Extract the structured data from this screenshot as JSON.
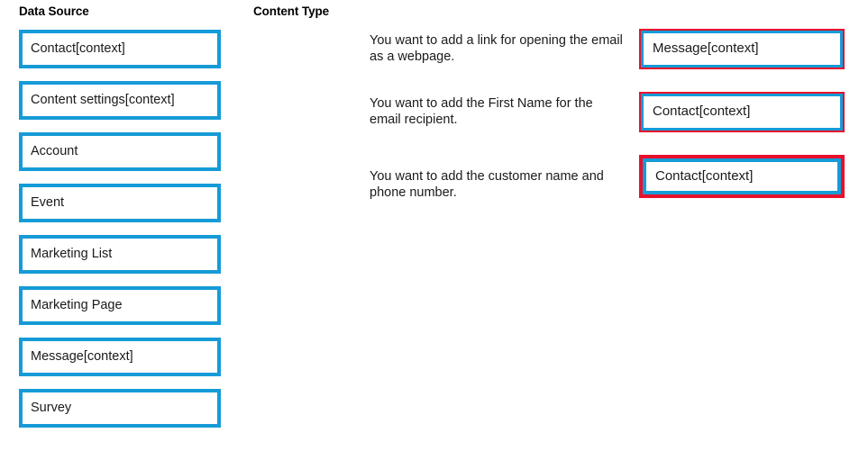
{
  "headings": {
    "data_source": "Data Source",
    "content_type": "Content Type"
  },
  "colors": {
    "box_blue": "#159BD7",
    "highlight_red": "#E8112D",
    "text": "#1a1a1a",
    "background": "#ffffff"
  },
  "data_source": {
    "options": [
      {
        "label": "Contact[context]"
      },
      {
        "label": "Content settings[context]"
      },
      {
        "label": "Account"
      },
      {
        "label": "Event"
      },
      {
        "label": "Marketing List"
      },
      {
        "label": "Marketing Page"
      },
      {
        "label": "Message[context]"
      },
      {
        "label": "Survey"
      }
    ]
  },
  "content_type": {
    "rows": [
      {
        "prompt": "You want to add a link for opening the email as a webpage.",
        "answer": "Message[context]",
        "highlight": "thin"
      },
      {
        "prompt": "You want to add the First Name for the email recipient.",
        "answer": "Contact[context]",
        "highlight": "thin"
      },
      {
        "prompt": "You want to add the customer name and phone number.",
        "answer": "Contact[context]",
        "highlight": "thick"
      }
    ]
  }
}
